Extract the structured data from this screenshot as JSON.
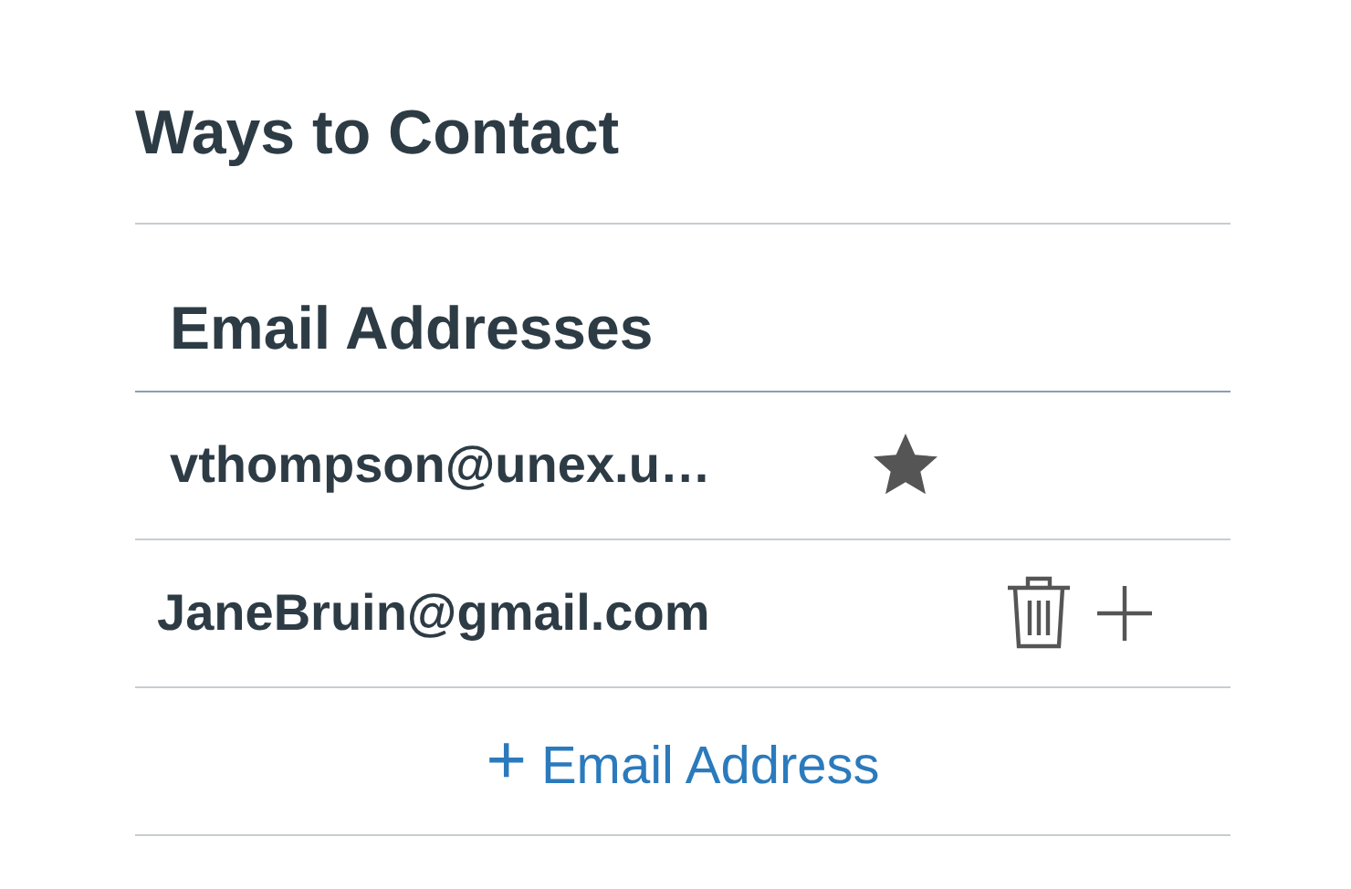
{
  "section_title": "Ways to Contact",
  "email_group": {
    "heading": "Email Addresses",
    "emails": [
      {
        "address": "vthompson@unex.u…",
        "default": true
      },
      {
        "address": "JaneBruin@gmail.com",
        "default": false
      }
    ],
    "add_link": {
      "icon": "+",
      "label": "Email Address"
    }
  }
}
